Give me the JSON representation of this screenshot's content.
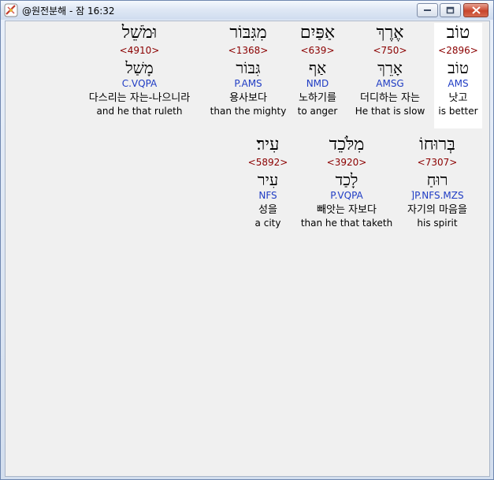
{
  "window": {
    "title": "@원전분해 - 잠 16:32"
  },
  "colors": {
    "strong": "#8b0000",
    "morph": "#1f3cc4"
  },
  "words": [
    {
      "heb": "טוֹב",
      "strong": "<2896>",
      "lemma": "טוֹב",
      "morph": "AMS",
      "korean": "낫고",
      "english": "is better",
      "highlight": true
    },
    {
      "heb": "אֶרֶךְ",
      "strong": "<750>",
      "lemma": "אָרֵךְ",
      "morph": "AMSG",
      "korean": "더디하는 자는",
      "english": "He that is slow",
      "highlight": false
    },
    {
      "heb": "אַפַּיִם",
      "strong": "<639>",
      "lemma": "אַף",
      "morph": "NMD",
      "korean": "노하기를",
      "english": "to anger",
      "highlight": false
    },
    {
      "heb": "מִגִּבּוֹר",
      "strong": "<1368>",
      "lemma": "גִּבּוֹר",
      "morph": "P.AMS",
      "korean": "용사보다",
      "english": "than the mighty",
      "highlight": false
    },
    {
      "heb": "וּמֹשֵׁל",
      "strong": "<4910>",
      "lemma": "מָשַׁל",
      "morph": "C.VQPA",
      "korean": "다스리는 자는-나으니라",
      "english": "and he that ruleth",
      "highlight": false
    },
    {
      "heb": "בְּרוּחוֹ",
      "strong": "<7307>",
      "lemma": "רוּחַ",
      "morph": "]P.NFS.MZS",
      "korean": "자기의 마음을",
      "english": "his spirit",
      "highlight": false
    },
    {
      "heb": "מִלֹּכֵד",
      "strong": "<3920>",
      "lemma": "לָכַד",
      "morph": "P.VQPA",
      "korean": "빼앗는 자보다",
      "english": "than he that taketh",
      "highlight": false
    },
    {
      "heb": "עִיר׃",
      "strong": "<5892>",
      "lemma": "עִיר",
      "morph": "NFS",
      "korean": "성을",
      "english": "a city",
      "highlight": false
    }
  ]
}
